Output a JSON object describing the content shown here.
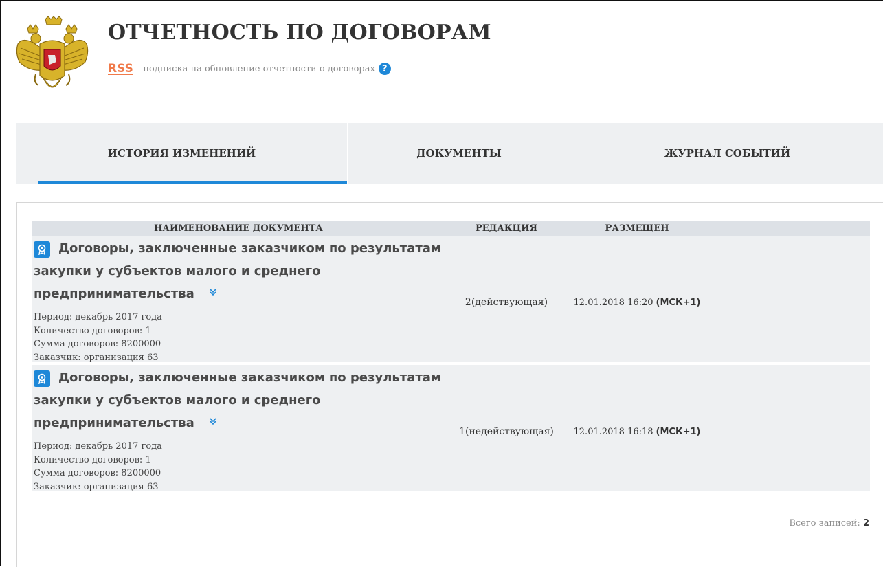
{
  "header": {
    "title": "ОТЧЕТНОСТЬ ПО ДОГОВОРАМ",
    "rss_label": "RSS",
    "rss_description": "- подписка на обновление отчетности о договорах",
    "help_icon": "question-circle-icon",
    "help_glyph": "?"
  },
  "tabs": [
    {
      "label": "ИСТОРИЯ ИЗМЕНЕНИЙ",
      "active": true
    },
    {
      "label": "ДОКУМЕНТЫ",
      "active": false
    },
    {
      "label": "ЖУРНАЛ СОБЫТИЙ",
      "active": false
    }
  ],
  "table": {
    "columns": {
      "name": "НАИМЕНОВАНИЕ ДОКУМЕНТА",
      "edition": "РЕДАКЦИЯ",
      "posted": "РАЗМЕЩЕН"
    },
    "rows": [
      {
        "title": "Договоры, заключенные заказчиком по результатам закупки у субъектов малого и среднего предпринимательства",
        "period": "Период: декабрь 2017 года",
        "count": "Количество договоров: 1",
        "sum": "Сумма договоров: 8200000",
        "customer": "Заказчик: организация 63",
        "edition": "2(действующая)",
        "posted_date": "12.01.2018 16:20",
        "posted_tz": "(МСК+1)"
      },
      {
        "title": "Договоры, заключенные заказчиком по результатам закупки у субъектов малого и среднего предпринимательства",
        "period": "Период: декабрь 2017 года",
        "count": "Количество договоров: 1",
        "sum": "Сумма договоров: 8200000",
        "customer": "Заказчик: организация 63",
        "edition": "1(недействующая)",
        "posted_date": "12.01.2018 16:18",
        "posted_tz": "(МСК+1)"
      }
    ]
  },
  "footer": {
    "total_label": "Всего записей:",
    "total_value": "2"
  },
  "icons": {
    "emblem": "coat-of-arms-icon",
    "doc": "award-badge-icon",
    "expand": "double-chevron-down-icon"
  },
  "colors": {
    "accent": "#1e88d8",
    "rss": "#f07a4a",
    "tab_bg": "#eef0f2",
    "header_row_bg": "#dde1e6"
  }
}
